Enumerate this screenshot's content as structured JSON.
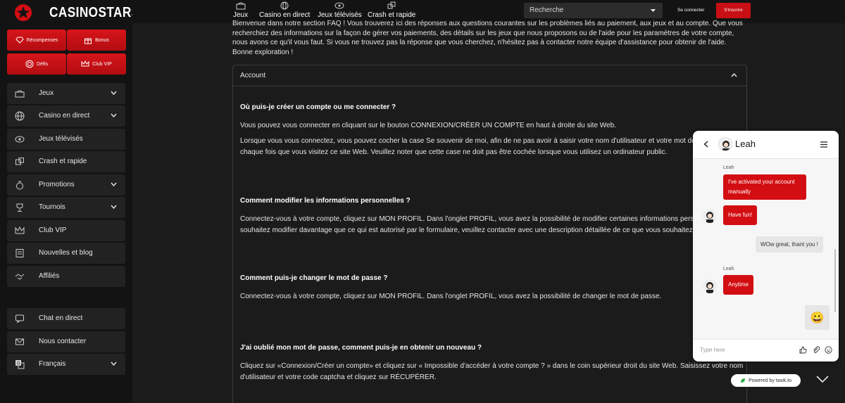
{
  "brand": {
    "name": "CASINOSTARS",
    "accent": "#d30e12"
  },
  "sidebar": {
    "promos": [
      {
        "label": "Récompenses",
        "icon": "diamond-icon"
      },
      {
        "label": "Bonus",
        "icon": "gift-icon"
      },
      {
        "label": "Défis",
        "icon": "target-icon"
      },
      {
        "label": "Club VIP",
        "icon": "crown-icon"
      }
    ],
    "items": [
      {
        "label": "Jeux",
        "icon": "slot-machine-icon",
        "has_chevron": true
      },
      {
        "label": "Casino en direct",
        "icon": "globe-icon",
        "has_chevron": true
      },
      {
        "label": "Jeux télévisés",
        "icon": "tv-games-icon",
        "has_chevron": false
      },
      {
        "label": "Crash et rapide",
        "icon": "dice-icon",
        "has_chevron": false
      },
      {
        "label": "Promotions",
        "icon": "money-bag-icon",
        "has_chevron": true
      },
      {
        "label": "Tournois",
        "icon": "trophy-icon",
        "has_chevron": true
      },
      {
        "label": "Club VIP",
        "icon": "crown-icon",
        "has_chevron": false
      },
      {
        "label": "Nouvelles et blog",
        "icon": "news-icon",
        "has_chevron": false
      },
      {
        "label": "Affiliés",
        "icon": "handshake-icon",
        "has_chevron": false
      }
    ],
    "bottom": [
      {
        "label": "Chat en direct",
        "icon": "chat-icon"
      },
      {
        "label": "Nous contacter",
        "icon": "mail-icon"
      },
      {
        "label": "Français",
        "icon": "translate-icon",
        "has_chevron": true
      }
    ]
  },
  "topnav": {
    "items": [
      {
        "label": "Jeux",
        "icon": "slot-machine-icon"
      },
      {
        "label": "Casino en direct",
        "icon": "globe-icon"
      },
      {
        "label": "Jeux télévisés",
        "icon": "tv-games-icon"
      },
      {
        "label": "Crash et rapide",
        "icon": "dice-icon"
      }
    ],
    "search_value": "Recherche",
    "login_label": "Se connecter",
    "signup_label": "S'inscrire"
  },
  "faq": {
    "intro": "Bienvenue dans notre section FAQ ! Vous trouverez ici des réponses aux questions courantes sur les problèmes liés au paiement, aux jeux et au compte. Que vous recherchiez des informations sur la façon de gérer vos paiements, des détails sur les jeux que nous proposons ou de l'aide pour les paramètres de votre compte, nous avons ce qu'il vous faut. Si vous ne trouvez pas la réponse que vous cherchez, n'hésitez pas à contacter notre équipe d'assistance pour obtenir de l'aide. Bonne exploration !",
    "section_title": "Account",
    "entries": [
      {
        "q": "Où puis-je créer un compte ou me connecter ?",
        "a": [
          "Vous pouvez vous connecter en cliquant sur le bouton CONNEXION/CRÉER UN COMPTE en haut à droite du site Web.",
          "Lorsque vous vous connectez, vous pouvez cocher la case Se souvenir de moi, afin de ne pas avoir à saisir votre nom d'utilisateur et votre mot de passe à chaque fois que vous visitez ce site Web. Veuillez noter que cette case ne doit pas être cochée lorsque vous utilisez un ordinateur public."
        ]
      },
      {
        "q": "Comment modifier les informations personnelles ?",
        "a": [
          "Connectez-vous à votre compte, cliquez sur MON PROFIL. Dans l'onglet PROFIL, vous avez la possibilité de modifier certaines informations personnelles. Si vous souhaitez modifier davantage que ce qui est autorisé par le formulaire, veuillez contacter avec une description détaillée de ce que vous souhaitez modifier."
        ]
      },
      {
        "q": "Comment puis-je changer le mot de passe ?",
        "a": [
          "Connectez-vous à votre compte, cliquez sur MON PROFIL. Dans l'onglet PROFIL, vous avez la possibilité de changer le mot de passe."
        ]
      },
      {
        "q": "J'ai oublié mon mot de passe, comment puis-je en obtenir un nouveau ?",
        "a": [
          "Cliquez sur «Connexion/Créer un compte» et cliquez sur « Impossible d'accéder à votre compte ? » dans le coin supérieur droit du site Web. Saisissez votre nom d'utilisateur et votre code captcha et cliquez sur RÉCUPÉRER."
        ]
      }
    ]
  },
  "chat": {
    "agent_name": "Leah",
    "messages": [
      {
        "from": "agent",
        "sender": "Leah",
        "text": "I've activated your account manually"
      },
      {
        "from": "agent",
        "text": "Have fun!"
      },
      {
        "from": "user",
        "text": "WOw great, thant you !"
      },
      {
        "from": "agent",
        "sender": "Leah",
        "text": "Anytime"
      },
      {
        "from": "user",
        "text": "😀"
      }
    ],
    "input_placeholder": "Type here",
    "powered_by": "Powered by tawk.to"
  }
}
